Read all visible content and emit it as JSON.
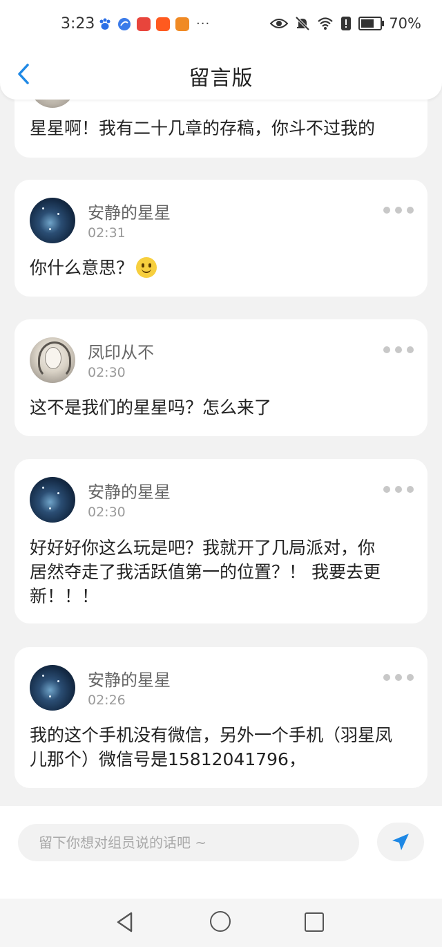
{
  "status_bar": {
    "time": "3:23",
    "more": "···",
    "battery": "70%",
    "battery_level": 0.7,
    "app_icons": [
      "baidu-icon",
      "browser-icon",
      "reader-icon",
      "taobao-icon",
      "video-icon"
    ],
    "system_icons": [
      "eye-icon",
      "mute-bell-icon",
      "wifi-icon",
      "alert-icon",
      "battery-icon"
    ]
  },
  "header": {
    "back_icon": "chevron-left-icon",
    "title": "留言版"
  },
  "messages": [
    {
      "text": "星星啊！我有二十几章的存稿，你斗不过我的"
    },
    {
      "author": "安静的星星",
      "time": "02:31",
      "text": "你什么意思？",
      "emoji": "slightly-smiling-face"
    },
    {
      "author": "凤印从不",
      "time": "02:30",
      "text": "这不是我们的星星吗？怎么来了"
    },
    {
      "author": "安静的星星",
      "time": "02:30",
      "line1": "好好好你这么玩是吧？我就开了几局派对，你",
      "line2": "居然夺走了我活跃值第一的位置？！ 我要去更",
      "line3": "新！！！"
    },
    {
      "author": "安静的星星",
      "time": "02:26",
      "line1": "我的这个手机没有微信，另外一个手机（羽星凤",
      "line2": "儿那个）微信号是15812041796，"
    }
  ],
  "composer": {
    "placeholder": "留下你想对组员说的话吧 ~",
    "send_icon": "paper-plane-icon"
  },
  "colors": {
    "accent": "#1e88e5",
    "background": "#f2f2f2",
    "card": "#ffffff"
  }
}
